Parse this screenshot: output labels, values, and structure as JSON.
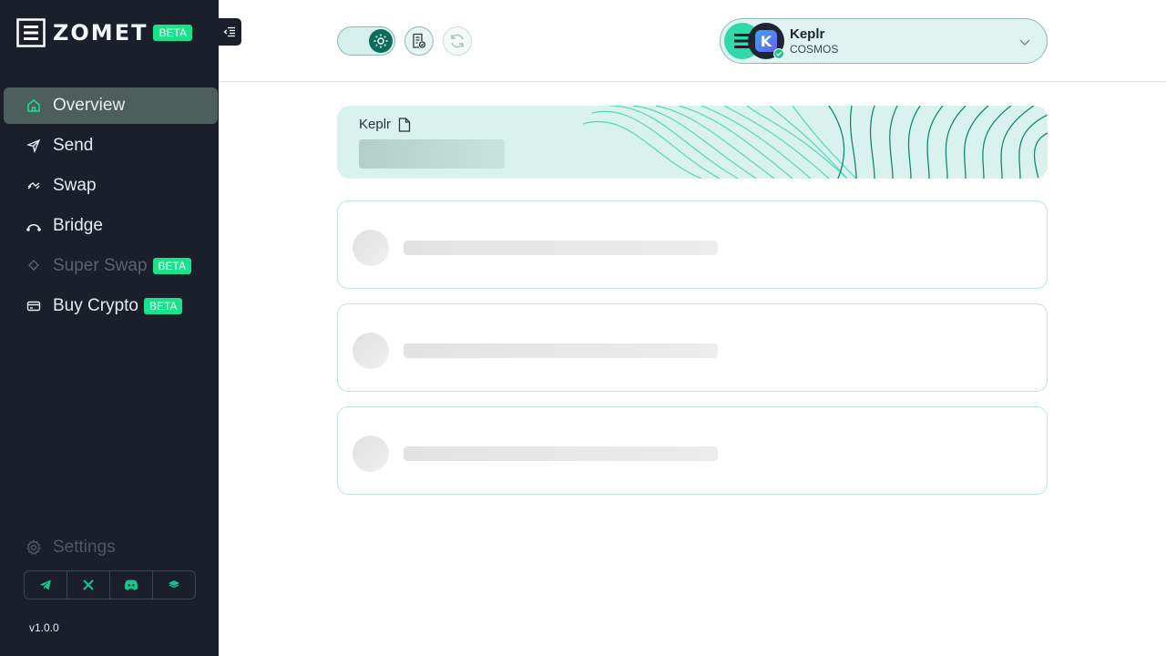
{
  "brand": {
    "name": "ZOMET",
    "badge": "BETA"
  },
  "sidebar": {
    "items": [
      {
        "label": "Overview",
        "icon": "home-icon",
        "active": true
      },
      {
        "label": "Send",
        "icon": "send-icon"
      },
      {
        "label": "Swap",
        "icon": "swap-icon"
      },
      {
        "label": "Bridge",
        "icon": "bridge-icon"
      },
      {
        "label": "Super Swap",
        "icon": "super-swap-icon",
        "badge": "BETA",
        "disabled": true
      },
      {
        "label": "Buy Crypto",
        "icon": "card-icon",
        "badge": "BETA"
      }
    ],
    "settings_label": "Settings",
    "socials": [
      "telegram-icon",
      "x-icon",
      "discord-icon",
      "docs-icon"
    ],
    "version": "v1.0.0"
  },
  "header": {
    "theme_toggle_icon": "sun-icon",
    "wallet": {
      "name": "Keplr",
      "chain": "COSMOS"
    }
  },
  "main": {
    "balance_card": {
      "wallet_label": "Keplr"
    },
    "asset_rows_loading": 3
  },
  "colors": {
    "sidebar_bg": "#1b1f2a",
    "accent": "#19e28a",
    "active_item_bg": "#4d5f5c",
    "banner_bg": "#d9f2ee",
    "card_border": "#bfe6de"
  }
}
